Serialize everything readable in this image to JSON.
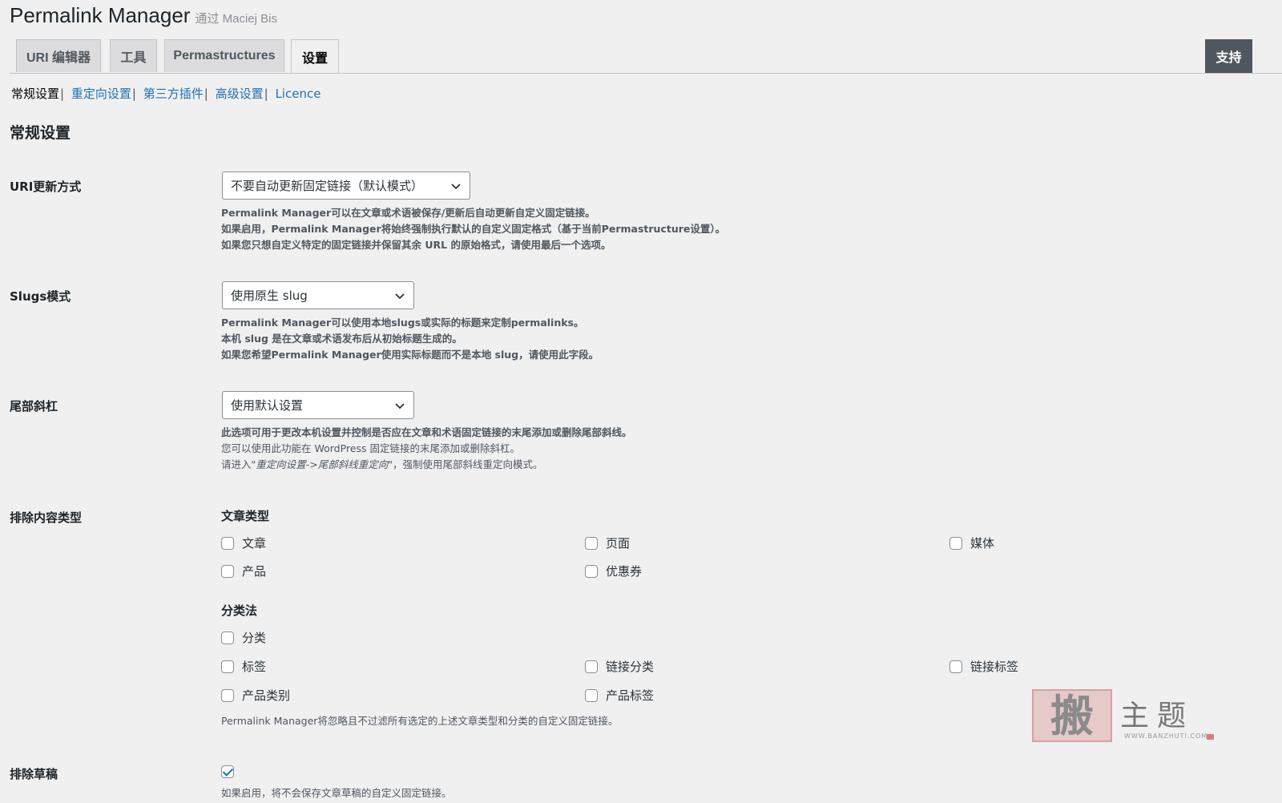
{
  "header": {
    "title": "Permalink Manager",
    "by": "通过 Maciej Bis"
  },
  "tabs": [
    {
      "label": "URI 编辑器"
    },
    {
      "label": "工具"
    },
    {
      "label": "Permastructures"
    },
    {
      "label": "设置"
    }
  ],
  "support_label": "支持",
  "subnav": {
    "current": "常规设置",
    "links": [
      "重定向设置",
      "第三方插件",
      "高级设置",
      "Licence"
    ],
    "separator": "|"
  },
  "section_title": "常规设置",
  "uri_update": {
    "label": "URI更新方式",
    "value": "不要自动更新固定链接（默认模式）",
    "desc": [
      "Permalink Manager可以在文章或术语被保存/更新后自动更新自定义固定链接。",
      "如果启用，Permalink Manager将始终强制执行默认的自定义固定格式（基于当前Permastructure设置）。",
      "如果您只想自定义特定的固定链接并保留其余 URL 的原始格式，请使用最后一个选项。"
    ]
  },
  "slugs_mode": {
    "label": "Slugs模式",
    "value": "使用原生 slug",
    "desc": [
      "Permalink Manager可以使用本地slugs或实际的标题来定制permalinks。",
      "本机 slug 是在文章或术语发布后从初始标题生成的。",
      "如果您希望Permalink Manager使用实际标题而不是本地 slug，请使用此字段。"
    ]
  },
  "trailing_slash": {
    "label": "尾部斜杠",
    "value": "使用默认设置",
    "desc1": "此选项可用于更改本机设置并控制是否应在文章和术语固定链接的末尾添加或删除尾部斜线。",
    "desc2": "您可以使用此功能在 WordPress 固定链接的末尾添加或删除斜杠。",
    "desc3_prefix": "请进入\"",
    "desc3_em": "重定向设置->尾部斜线重定向",
    "desc3_suffix": "\"，强制使用尾部斜线重定向模式。"
  },
  "exclude_types": {
    "label": "排除内容类型",
    "post_types_title": "文章类型",
    "post_types": [
      {
        "label": "文章",
        "checked": false
      },
      {
        "label": "页面",
        "checked": false
      },
      {
        "label": "媒体",
        "checked": false
      },
      {
        "label": "产品",
        "checked": false
      },
      {
        "label": "优惠券",
        "checked": false
      }
    ],
    "taxonomies_title": "分类法",
    "taxonomies": [
      {
        "label": "分类",
        "checked": false
      },
      {
        "label": "标签",
        "checked": false
      },
      {
        "label": "链接分类",
        "checked": false
      },
      {
        "label": "链接标签",
        "checked": false
      },
      {
        "label": "产品类别",
        "checked": false
      },
      {
        "label": "产品标签",
        "checked": false
      }
    ],
    "desc": "Permalink Manager将忽略且不过滤所有选定的上述文章类型和分类的自定义固定链接。"
  },
  "exclude_drafts": {
    "label": "排除草稿",
    "checked": true,
    "desc": "如果启用，将不会保存文章草稿的自定义固定链接。"
  },
  "watermark": {
    "stamp": "搬",
    "text": "主题",
    "url": "WWW.BANZHUTI.COM"
  },
  "colors": {
    "link": "#2271b1",
    "background": "#f0f0f1",
    "support_bg": "#50575e",
    "checkmark": "#2271b1"
  }
}
